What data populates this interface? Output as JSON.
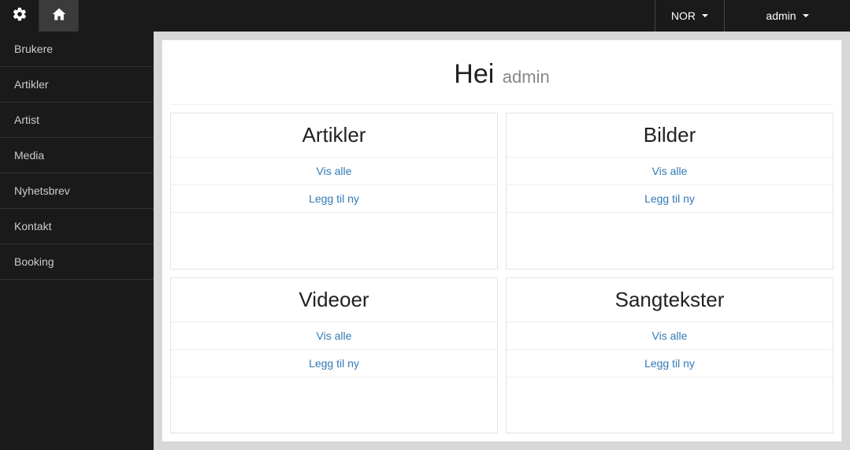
{
  "topbar": {
    "language_label": "NOR",
    "user_label": "admin"
  },
  "sidebar": {
    "items": [
      {
        "label": "Brukere"
      },
      {
        "label": "Artikler"
      },
      {
        "label": "Artist"
      },
      {
        "label": "Media"
      },
      {
        "label": "Nyhetsbrev"
      },
      {
        "label": "Kontakt"
      },
      {
        "label": "Booking"
      }
    ]
  },
  "greeting": {
    "hello": "Hei",
    "username": "admin"
  },
  "labels": {
    "view_all": "Vis alle",
    "add_new": "Legg til ny"
  },
  "cards": [
    {
      "title": "Artikler"
    },
    {
      "title": "Bilder"
    },
    {
      "title": "Videoer"
    },
    {
      "title": "Sangtekster"
    }
  ]
}
